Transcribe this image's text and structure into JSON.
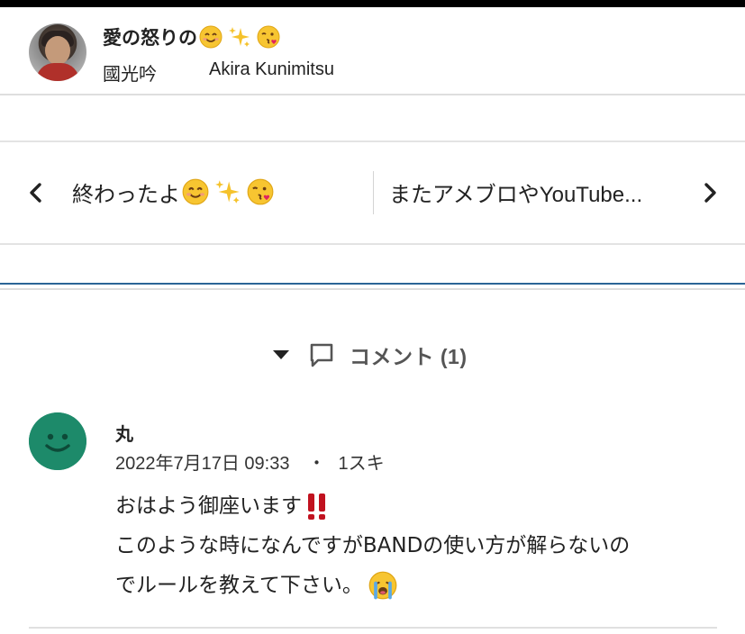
{
  "blog": {
    "title": "愛の怒りの",
    "title_emojis": [
      "smiling-face-icon",
      "sparkles-icon",
      "face-blowing-kiss-icon"
    ],
    "author_kanji": "國光吟",
    "author_romaji": "Akira Kunimitsu"
  },
  "pager": {
    "prev_label": "終わったよ",
    "prev_emojis": [
      "smiling-face-icon",
      "sparkles-icon",
      "face-blowing-kiss-icon"
    ],
    "next_label": "またアメブロやYouTube..."
  },
  "comments": {
    "toggle_label": "コメント (1)",
    "items": [
      {
        "name": "丸",
        "date": "2022年7月17日 09:33",
        "separator": "・",
        "likes": "1スキ",
        "body_line1": "おはよう御座います",
        "body_line2": "このような時になんですがBANDの使い方が解らないの",
        "body_line3": "でルールを教えて下さい。",
        "body_emojis": [
          "double-exclamation-icon",
          "crying-face-icon"
        ]
      }
    ]
  },
  "colors": {
    "accent_rule": "#2a6496",
    "comment_avatar": "#1d8a6a",
    "emoji_yellow": "#f7c531",
    "exclamation_red": "#c1121f"
  }
}
